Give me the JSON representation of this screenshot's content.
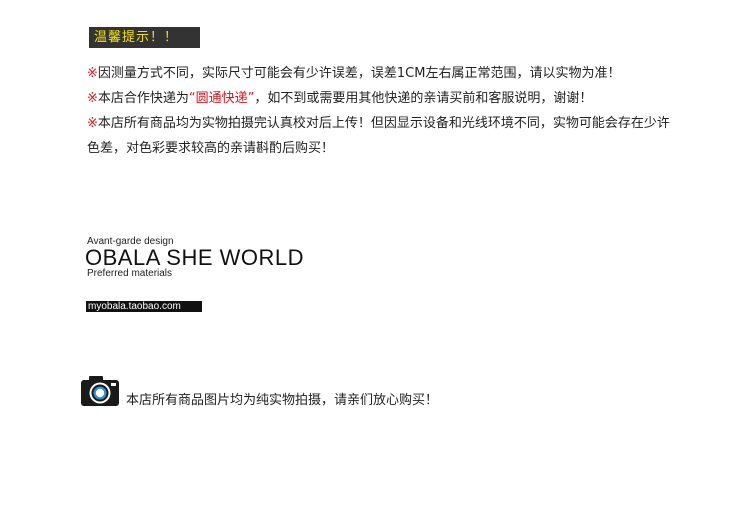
{
  "tip": {
    "title": "温馨提示！！"
  },
  "notices": [
    {
      "mark": "※",
      "text": "因测量方式不同，实际尺寸可能会有少许误差，误差1CM左右属正常范围，请以实物为准！"
    },
    {
      "mark": "※",
      "before": "本店合作快递为",
      "highlight": "“圆通快递”",
      "after": "，如不到或需要用其他快递的亲请买前和客服说明，谢谢！"
    },
    {
      "mark": "※",
      "text": "本店所有商品均为实物拍摄完认真校对后上传！但因显示设备和光线环境不同，实物可能会存在少许色差，对色彩要求较高的亲请斟酌后购买！"
    }
  ],
  "brand": {
    "tagline": "Avant-garde design",
    "name": "OBALA SHE WORLD",
    "sub": "Preferred materials",
    "url": "myobala.taobao.com"
  },
  "photo_note": {
    "icon": "camera-icon",
    "text": "本店所有商品图片均为纯实物拍摄，请亲们放心购买！"
  },
  "colors": {
    "accent_red": "#d9161c",
    "badge_bg": "#333333",
    "badge_text": "#f3e20a"
  }
}
